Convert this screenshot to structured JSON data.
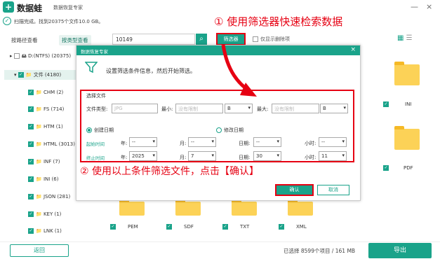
{
  "app": {
    "brand": "数据蛙",
    "subtitle": "数据恢复专家",
    "minimize": "—",
    "close": "×"
  },
  "status": {
    "scan_text": "扫描完成。找到20375个文件10.0 GB。"
  },
  "annotations": {
    "step1": "① 使用筛选器快速检索数据",
    "step2": "② 使用以上条件筛选文件，点击【确认】"
  },
  "tabs": [
    {
      "label": "按路径查看"
    },
    {
      "label": "按类型查看"
    }
  ],
  "search": {
    "value": "10149"
  },
  "filter_button": "筛选器",
  "show_deleted": "仅显示删除项",
  "tree": [
    {
      "label": "D:(NTFS) (20375)"
    },
    {
      "label": "文件 (4180)"
    },
    {
      "label": "CHM (2)"
    },
    {
      "label": "FS (714)"
    },
    {
      "label": "HTM (1)"
    },
    {
      "label": "HTML (3013)"
    },
    {
      "label": "INF (7)"
    },
    {
      "label": "INI (6)"
    },
    {
      "label": "JSON (281)"
    },
    {
      "label": "KEY (1)"
    },
    {
      "label": "LNK (1)"
    }
  ],
  "right_files": [
    {
      "label": "INI"
    },
    {
      "label": "PDF"
    }
  ],
  "bottom_files": [
    {
      "label": "PEM"
    },
    {
      "label": "SDF"
    },
    {
      "label": "TXT"
    },
    {
      "label": "XML"
    }
  ],
  "dialog": {
    "title": "数据恢复专家",
    "description": "设置筛选条件信息，然后开始筛选。",
    "section": "选择文件",
    "file_type_label": "文件类型:",
    "file_type_placeholder": "JPG",
    "min_label": "最小:",
    "min_placeholder": "没有限制",
    "min_unit": "B",
    "max_label": "最大:",
    "max_placeholder": "没有限制",
    "max_unit": "B",
    "created_label": "创建日期",
    "modified_label": "修改日期",
    "start_label": "起始时间",
    "end_label": "终止时间",
    "year": "年:",
    "month": "月:",
    "day": "日期:",
    "hour": "小时:",
    "start": {
      "year": "--",
      "month": "--",
      "day": "--",
      "hour": "--"
    },
    "end": {
      "year": "2025",
      "month": "7",
      "day": "30",
      "hour": "11"
    },
    "confirm": "确认",
    "cancel": "取消"
  },
  "bottom": {
    "back": "返回",
    "selected": "已选择 8599个项目 / 161 MB",
    "export": "导出"
  },
  "colors": {
    "accent": "#1aa38a",
    "annotation": "#e60012",
    "folder": "#fcd257"
  }
}
